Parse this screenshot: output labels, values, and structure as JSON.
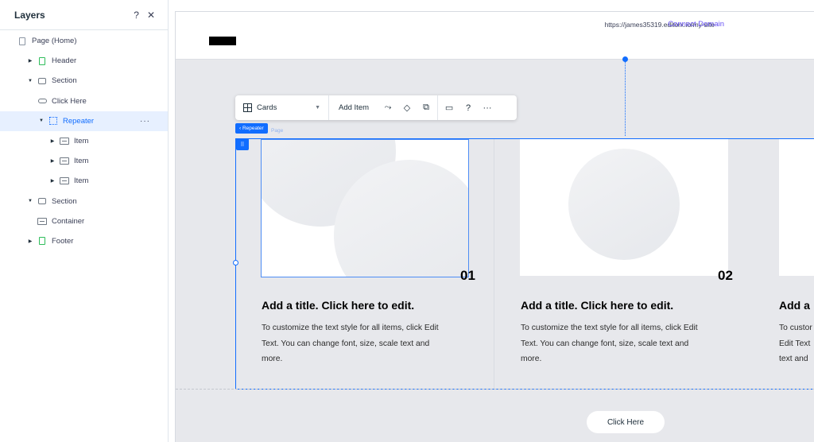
{
  "layers_panel": {
    "title": "Layers",
    "help_icon": "?",
    "close_icon": "✕",
    "items": [
      {
        "label": "Page (Home)",
        "icon": "page-icon"
      },
      {
        "label": "Header",
        "icon": "header-icon",
        "expand": "collapsed"
      },
      {
        "label": "Section",
        "icon": "section-icon",
        "expand": "expanded"
      },
      {
        "label": "Click Here",
        "icon": "button-icon"
      },
      {
        "label": "Repeater",
        "icon": "repeater-icon",
        "expand": "expanded",
        "selected": true,
        "more": "···"
      },
      {
        "label": "Item",
        "icon": "item-icon",
        "expand": "collapsed"
      },
      {
        "label": "Item",
        "icon": "item-icon",
        "expand": "collapsed"
      },
      {
        "label": "Item",
        "icon": "item-icon",
        "expand": "collapsed"
      },
      {
        "label": "Section",
        "icon": "section-icon",
        "expand": "expanded"
      },
      {
        "label": "Container",
        "icon": "container-icon"
      },
      {
        "label": "Footer",
        "icon": "footer-icon",
        "expand": "collapsed"
      }
    ]
  },
  "site_header": {
    "url": "https://james35319.editorx.io/my-site",
    "connect_domain": "Connect Domain"
  },
  "toolbar": {
    "layout_label": "Cards",
    "add_item_label": "Add Item",
    "help_label": "?",
    "more_label": "···"
  },
  "repeater": {
    "tag_label": "‹ Repeater",
    "ghost_label": "Page",
    "handle_icon": "⠿"
  },
  "cards": [
    {
      "number": "01",
      "title": "Add a title. Click here to edit.",
      "body": "To customize the text style for all items, click Edit Text. You can change font, size, scale text and more."
    },
    {
      "number": "02",
      "title": "Add a title. Click here to edit.",
      "body": "To customize the text style for all items, click Edit Text. You can change font, size, scale text and more."
    },
    {
      "number": "",
      "title": "Add a",
      "body": "To custor Edit Text text and"
    }
  ],
  "click_here_button": "Click Here",
  "colors": {
    "accent": "#116dff",
    "connect": "#6852f5",
    "canvas_bg": "#e7e8ec"
  }
}
